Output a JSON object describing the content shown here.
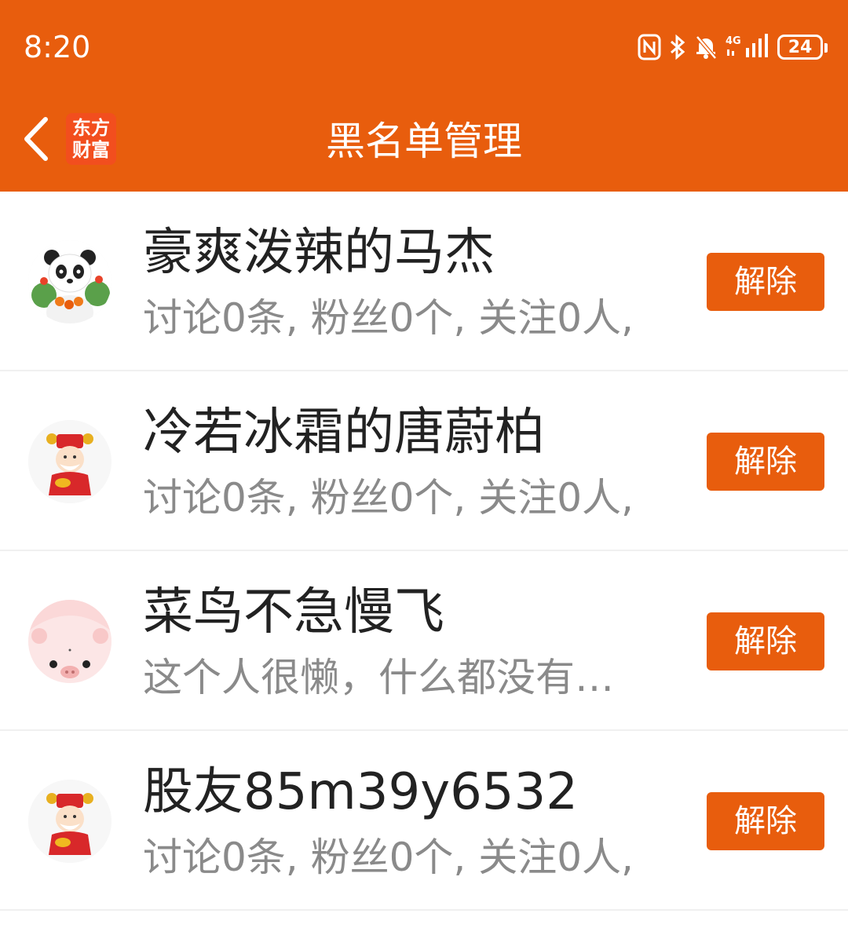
{
  "status_bar": {
    "time": "8:20",
    "network_label": "4G",
    "battery": "24",
    "icons": [
      "nfc-icon",
      "bluetooth-icon",
      "bell-off-icon",
      "signal-icon",
      "battery-icon"
    ]
  },
  "header": {
    "title": "黑名单管理",
    "logo_line1": "东方",
    "logo_line2": "财富",
    "accent_color": "#e85d0d"
  },
  "blacklist": [
    {
      "name": "豪爽泼辣的马杰",
      "desc": "讨论0条, 粉丝0个, 关注0人,",
      "button": "解除",
      "avatar": "panda-avatar"
    },
    {
      "name": "冷若冰霜的唐蔚柏",
      "desc": "讨论0条, 粉丝0个, 关注0人,",
      "button": "解除",
      "avatar": "fortune-god-avatar"
    },
    {
      "name": "菜鸟不急慢飞",
      "desc": "这个人很懒，什么都没有…",
      "button": "解除",
      "avatar": "pig-avatar"
    },
    {
      "name": "股友85m39y6532",
      "desc": "讨论0条, 粉丝0个, 关注0人,",
      "button": "解除",
      "avatar": "fortune-god-avatar"
    }
  ]
}
